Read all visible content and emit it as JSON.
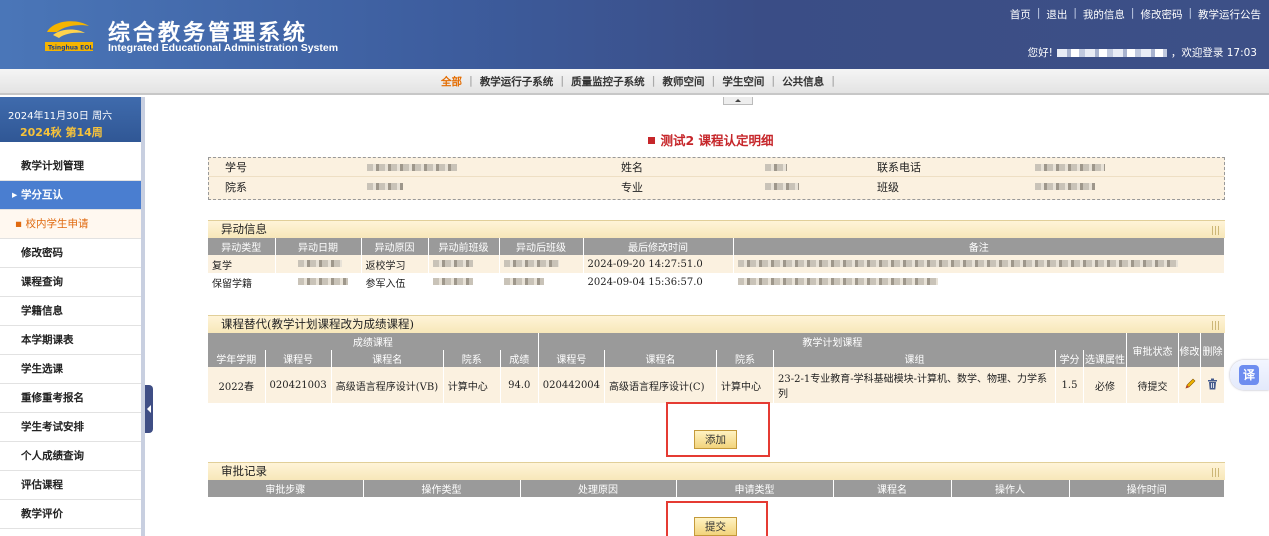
{
  "app": {
    "title": "综合教务管理系统",
    "subtitle": "Integrated Educational Administration System",
    "logo_text": "Tsinghua EOL"
  },
  "toplinks": [
    "首页",
    "退出",
    "我的信息",
    "修改密码",
    "教学运行公告"
  ],
  "welcome": {
    "prefix": "您好!",
    "suffix": "，欢迎登录 17:03"
  },
  "nav": {
    "items": [
      "全部",
      "教学运行子系统",
      "质量监控子系统",
      "教师空间",
      "学生空间",
      "公共信息"
    ],
    "active_index": 0
  },
  "sidebar": {
    "date": "2024年11月30日  周六",
    "week": "2024秋 第14周",
    "items": [
      {
        "label": "教学计划管理"
      },
      {
        "label": "学分互认",
        "active": true
      },
      {
        "label": "校内学生申请",
        "sub": true
      },
      {
        "label": "修改密码"
      },
      {
        "label": "课程查询"
      },
      {
        "label": "学籍信息"
      },
      {
        "label": "本学期课表"
      },
      {
        "label": "学生选课"
      },
      {
        "label": "重修重考报名"
      },
      {
        "label": "学生考试安排"
      },
      {
        "label": "个人成绩查询"
      },
      {
        "label": "评估课程"
      },
      {
        "label": "教学评价"
      }
    ]
  },
  "page_title": "测试2 课程认定明细",
  "student_info": {
    "labels": {
      "student_no": "学号",
      "name": "姓名",
      "phone": "联系电话",
      "dept": "院系",
      "major": "专业",
      "class": "班级"
    }
  },
  "change_info": {
    "title": "异动信息",
    "headers": [
      "异动类型",
      "异动日期",
      "异动原因",
      "异动前班级",
      "异动后班级",
      "最后修改时间",
      "备注"
    ],
    "rows": [
      {
        "type": "复学",
        "reason": "返校学习",
        "modified": "2024-09-20 14:27:51.0"
      },
      {
        "type": "保留学籍",
        "reason": "参军入伍",
        "modified": "2024-09-04 15:36:57.0"
      }
    ]
  },
  "course_replace": {
    "title": "课程替代(教学计划课程改为成绩课程)",
    "group_headers": {
      "grade": "成绩课程",
      "plan": "教学计划课程"
    },
    "headers": [
      "学年学期",
      "课程号",
      "课程名",
      "院系",
      "成绩",
      "课程号",
      "课程名",
      "院系",
      "课组",
      "学分",
      "选课属性",
      "审批状态",
      "修改",
      "删除"
    ],
    "row": {
      "term": "2022春",
      "g_code": "020421003",
      "g_name": "高级语言程序设计(VB)",
      "g_dept": "计算中心",
      "score": "94.0",
      "p_code": "020442004",
      "p_name": "高级语言程序设计(C)",
      "p_dept": "计算中心",
      "group": "23-2-1专业教育-学科基础模块-计算机、数学、物理、力学系列",
      "credit": "1.5",
      "attr": "必修",
      "status": "待提交"
    },
    "add_label": "添加"
  },
  "approval": {
    "title": "审批记录",
    "headers": [
      "审批步骤",
      "操作类型",
      "处理原因",
      "申请类型",
      "课程名",
      "操作人",
      "操作时间"
    ],
    "submit_label": "提交"
  },
  "translate_label": "译"
}
